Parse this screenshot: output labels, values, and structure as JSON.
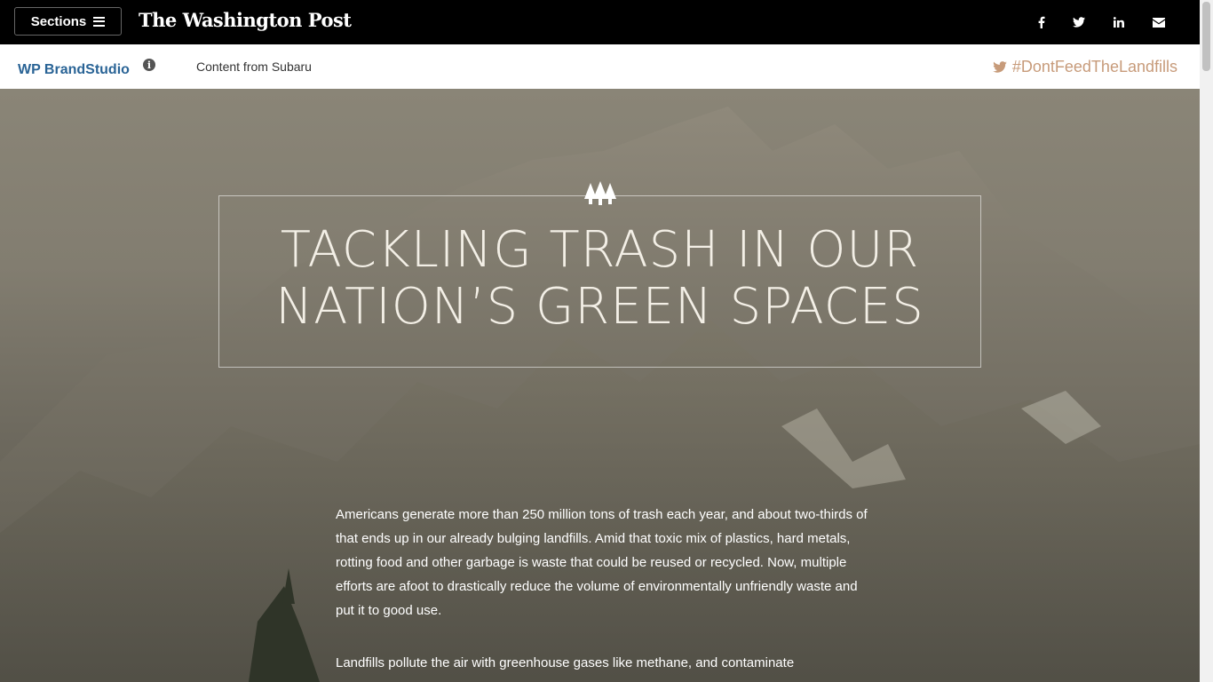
{
  "topbar": {
    "sections_label": "Sections",
    "logo_text": "The Washington Post",
    "social_icons": [
      "facebook-icon",
      "twitter-icon",
      "linkedin-icon",
      "email-icon"
    ]
  },
  "subbar": {
    "brand_label": "WP BrandStudio",
    "info_icon": "info-icon",
    "content_from": "Content from Subaru",
    "hashtag": "#DontFeedTheLandfills"
  },
  "hero": {
    "title_line1": "TACKLING TRASH IN OUR",
    "title_line2": "NATION’S GREEN SPACES",
    "icon": "trees-icon"
  },
  "article": {
    "paragraphs": [
      "Americans generate more than 250 million tons of trash each year, and about two-thirds of that ends up in our already bulging landfills. Amid that toxic mix of plastics, hard metals, rotting food and other garbage is waste that could be reused or recycled. Now, multiple efforts are afoot to drastically reduce the volume of environmentally unfriendly waste and put it to good use.",
      "Landfills pollute the air with greenhouse gases like methane, and contaminate"
    ]
  },
  "colors": {
    "brand_blue": "#2a6496",
    "hashtag": "#c79b7a",
    "topbar": "#000000"
  }
}
